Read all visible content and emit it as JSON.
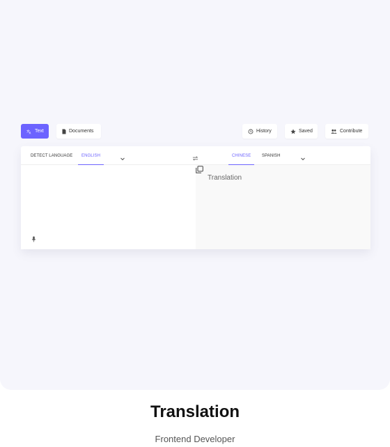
{
  "toolbar": {
    "text_label": "Text",
    "documents_label": "Documents",
    "history_label": "History",
    "saved_label": "Saved",
    "contribute_label": "Contribute",
    "icons": {
      "text": "translate-icon",
      "documents": "document-icon",
      "history": "history-icon",
      "saved": "star-icon",
      "contribute": "people-icon"
    }
  },
  "source": {
    "tabs": [
      "DETECT LANGUAGE",
      "ENGLISH"
    ],
    "active": "ENGLISH",
    "input_value": ""
  },
  "target": {
    "tabs": [
      "CHINESE",
      "SPANISH"
    ],
    "active": "CHINESE",
    "output_placeholder": "Translation"
  },
  "footer": {
    "title": "Translation",
    "subtitle": "Frontend Developer"
  },
  "colors": {
    "accent": "#6c63ff",
    "canvas_bg": "#f6f6fc",
    "target_bg": "#f9f9f9"
  }
}
